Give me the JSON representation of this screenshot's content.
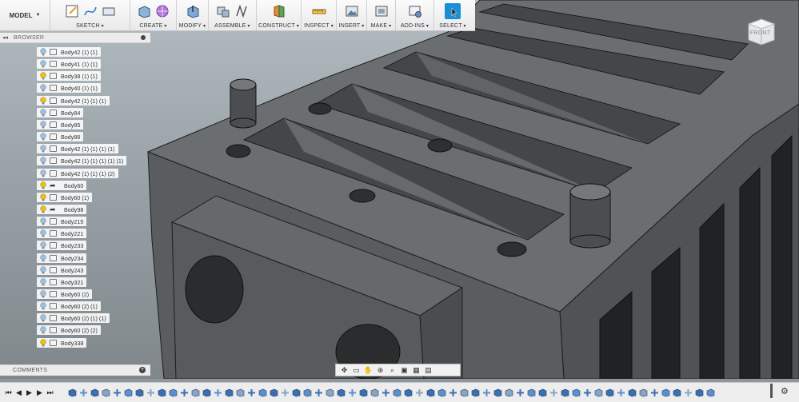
{
  "toolbar": {
    "workspace": "MODEL",
    "groups": [
      {
        "label": "SKETCH"
      },
      {
        "label": "CREATE"
      },
      {
        "label": "MODIFY"
      },
      {
        "label": "ASSEMBLE"
      },
      {
        "label": "CONSTRUCT"
      },
      {
        "label": "INSPECT"
      },
      {
        "label": "INSERT"
      },
      {
        "label": "MAKE"
      },
      {
        "label": "ADD-INS"
      },
      {
        "label": "SELECT"
      }
    ]
  },
  "browser": {
    "title": "BROWSER",
    "items": [
      {
        "label": "Body42 (1) (1)",
        "visible": false,
        "icon": "body"
      },
      {
        "label": "Body41 (1) (1)",
        "visible": false,
        "icon": "body"
      },
      {
        "label": "Body38 (1) (1)",
        "visible": true,
        "icon": "body"
      },
      {
        "label": "Body40 (1) (1)",
        "visible": false,
        "icon": "body"
      },
      {
        "label": "Body42 (1) (1) (1)",
        "visible": true,
        "icon": "body"
      },
      {
        "label": "Body84",
        "visible": false,
        "icon": "body"
      },
      {
        "label": "Body85",
        "visible": false,
        "icon": "body"
      },
      {
        "label": "Body86",
        "visible": false,
        "icon": "body"
      },
      {
        "label": "Body42 (1) (1) (1) (1)",
        "visible": false,
        "icon": "body"
      },
      {
        "label": "Body42 (1) (1) (1) (1) (1)",
        "visible": false,
        "icon": "body"
      },
      {
        "label": "Body42 (1) (1) (1) (2)",
        "visible": false,
        "icon": "body"
      },
      {
        "label": "Body60",
        "visible": true,
        "icon": "link"
      },
      {
        "label": "Body60 (1)",
        "visible": true,
        "icon": "body"
      },
      {
        "label": "Body98",
        "visible": true,
        "icon": "link"
      },
      {
        "label": "Body215",
        "visible": false,
        "icon": "body"
      },
      {
        "label": "Body221",
        "visible": false,
        "icon": "body"
      },
      {
        "label": "Body233",
        "visible": false,
        "icon": "body"
      },
      {
        "label": "Body234",
        "visible": false,
        "icon": "body"
      },
      {
        "label": "Body243",
        "visible": false,
        "icon": "body"
      },
      {
        "label": "Body321",
        "visible": false,
        "icon": "body"
      },
      {
        "label": "Body60 (2)",
        "visible": false,
        "icon": "body"
      },
      {
        "label": "Body60 (2) (1)",
        "visible": false,
        "icon": "body"
      },
      {
        "label": "Body60 (2) (1) (1)",
        "visible": false,
        "icon": "body"
      },
      {
        "label": "Body60 (2) (2)",
        "visible": false,
        "icon": "body"
      },
      {
        "label": "Body338",
        "visible": true,
        "icon": "body"
      }
    ]
  },
  "comments": {
    "title": "COMMENTS"
  },
  "viewcube": {
    "face": "FRONT"
  },
  "colors": {
    "bulb_on": "#f2c200",
    "bulb_off": "#9cc0e4",
    "select_accent": "#1a8fd6",
    "model_face": "#5b5e60"
  }
}
